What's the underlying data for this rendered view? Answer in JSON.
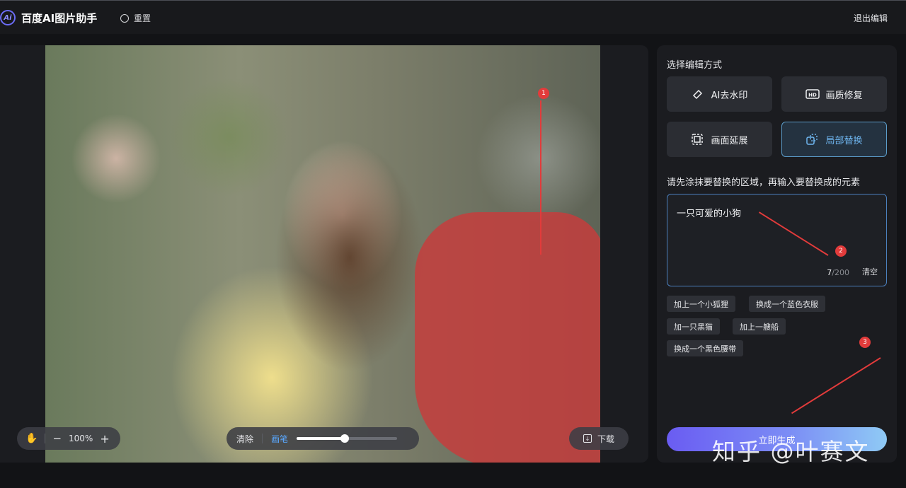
{
  "header": {
    "logo_text": "Ai",
    "app_title": "百度AI图片助手",
    "reset_label": "重置",
    "exit_label": "退出编辑"
  },
  "canvas": {
    "zoom_level": "100%",
    "zoom_out_symbol": "−",
    "zoom_in_symbol": "+",
    "erase_label": "清除",
    "brush_label": "画笔",
    "brush_size_fraction": 0.48,
    "download_label": "下载"
  },
  "annotations": [
    "1",
    "2",
    "3"
  ],
  "side": {
    "mode_title": "选择编辑方式",
    "modes": [
      {
        "label": "AI去水印",
        "icon": "eraser-icon"
      },
      {
        "label": "画质修复",
        "icon": "hd-icon"
      },
      {
        "label": "画面延展",
        "icon": "expand-icon"
      },
      {
        "label": "局部替换",
        "icon": "replace-icon",
        "active": true
      }
    ],
    "instruction": "请先涂抹要替换的区域，再输入要替换成的元素",
    "input_value": "一只可爱的小狗",
    "char_count": "7",
    "char_limit": "/200",
    "clear_label": "清空",
    "suggestions": [
      "加上一个小狐狸",
      "换成一个蓝色衣服",
      "加一只黑猫",
      "加上一艘船",
      "换成一个黑色腰带"
    ],
    "generate_label": "立即生成"
  },
  "watermark": "知乎 @叶赛文",
  "colors": {
    "accent_blue": "#5aa8ff",
    "annotation_red": "#e23b3b",
    "mask_red": "#c83c3c"
  }
}
